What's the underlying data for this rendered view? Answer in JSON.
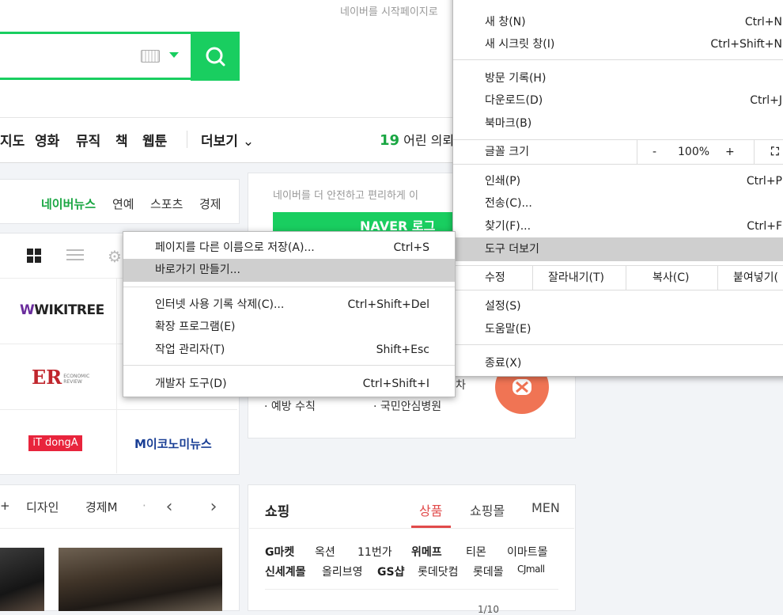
{
  "header": {
    "tagline": "네이버를 시작페이지로",
    "search_value": ""
  },
  "nav": {
    "items": [
      "지도",
      "영화",
      "뮤직",
      "책",
      "웹툰"
    ],
    "more": "더보기",
    "rank_number": "19",
    "rank_text": "어린 의뢰인"
  },
  "news": {
    "tabs": [
      "네이버뉴스",
      "연예",
      "스포츠",
      "경제"
    ],
    "logos": [
      "WIKITREE",
      "ER",
      "ECONOMIC REVIEW",
      "iT dongA",
      "M이코노미뉴스"
    ]
  },
  "safety": {
    "text": "네이버를 더 안전하고 편리하게 이",
    "login_label": "NAVER 로그",
    "items": [
      "예방 수칙",
      "국민안심병원",
      "차"
    ]
  },
  "channels": {
    "tabs": [
      "+",
      "디자인",
      "경제M",
      "·"
    ],
    "prev": "‹",
    "next": "›"
  },
  "shopping": {
    "title": "쇼핑",
    "tabs": [
      "상품",
      "쇼핑몰",
      "MEN"
    ],
    "row1": [
      "G마켓",
      "옥션",
      "11번가",
      "위메프",
      "티몬",
      "이마트몰"
    ],
    "row2": [
      "신세계몰",
      "올리브영",
      "GS샵",
      "롯데닷컴",
      "롯데몰",
      "CJmall"
    ],
    "pager": "1/10"
  },
  "chrome_menu": {
    "items_top": [
      {
        "label": "새 창(N)",
        "shortcut": "Ctrl+N"
      },
      {
        "label": "새 시크릿 창(I)",
        "shortcut": "Ctrl+Shift+N"
      }
    ],
    "items_history": [
      {
        "label": "방문 기록(H)",
        "shortcut": ""
      },
      {
        "label": "다운로드(D)",
        "shortcut": "Ctrl+J"
      },
      {
        "label": "북마크(B)",
        "shortcut": ""
      }
    ],
    "zoom": {
      "label": "글꼴 크기",
      "minus": "-",
      "value": "100%",
      "plus": "+"
    },
    "items_mid": [
      {
        "label": "인쇄(P)",
        "shortcut": "Ctrl+P"
      },
      {
        "label": "전송(C)...",
        "shortcut": ""
      },
      {
        "label": "찾기(F)...",
        "shortcut": "Ctrl+F"
      },
      {
        "label": "도구 더보기",
        "shortcut": ""
      }
    ],
    "edit": {
      "label": "수정",
      "cut": "잘라내기(T)",
      "copy": "복사(C)",
      "paste": "붙여넣기("
    },
    "items_bottom": [
      {
        "label": "설정(S)",
        "shortcut": ""
      },
      {
        "label": "도움말(E)",
        "shortcut": ""
      }
    ],
    "exit": {
      "label": "종료(X)",
      "shortcut": ""
    }
  },
  "more_tools_menu": {
    "items": [
      {
        "label": "페이지를 다른 이름으로 저장(A)...",
        "shortcut": "Ctrl+S"
      },
      {
        "label": "바로가기 만들기...",
        "shortcut": ""
      },
      {
        "label": "인터넷 사용 기록 삭제(C)...",
        "shortcut": "Ctrl+Shift+Del"
      },
      {
        "label": "확장 프로그램(E)",
        "shortcut": ""
      },
      {
        "label": "작업 관리자(T)",
        "shortcut": "Shift+Esc"
      },
      {
        "label": "개발자 도구(D)",
        "shortcut": "Ctrl+Shift+I"
      }
    ]
  },
  "colors": {
    "naver_green": "#19ce60",
    "highlight": "#cfcfcf",
    "shopping_red": "#e14a4a"
  }
}
